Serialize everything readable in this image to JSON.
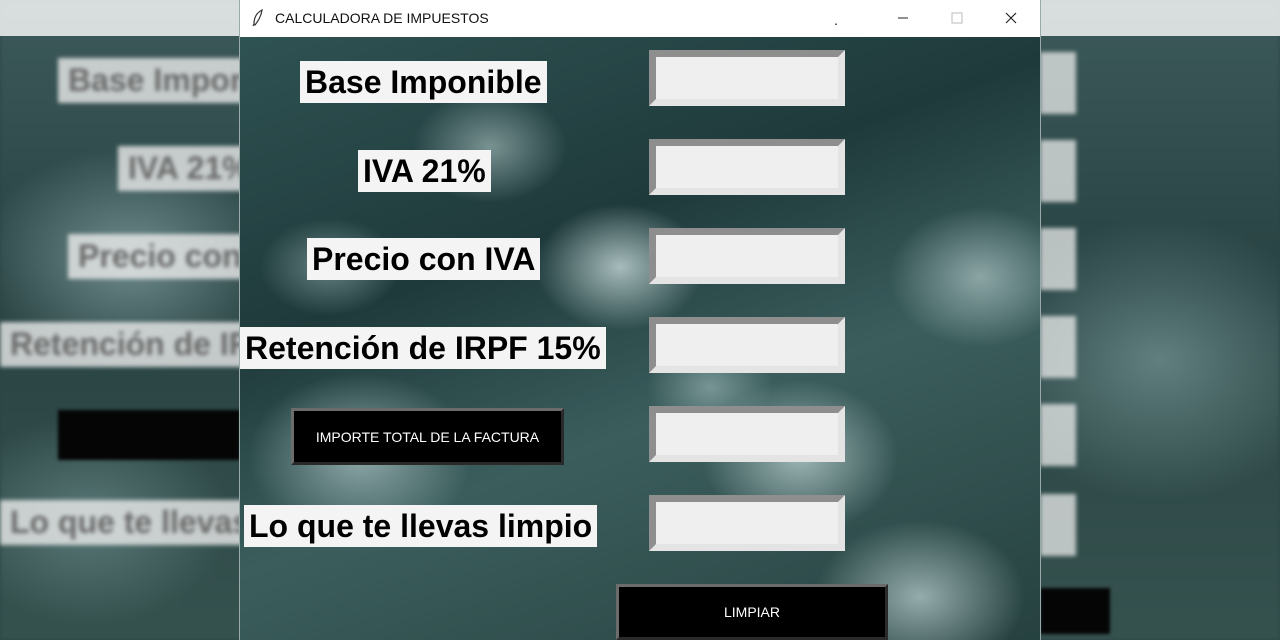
{
  "window": {
    "title": "CALCULADORA DE IMPUESTOS",
    "title_dot": ".",
    "controls": {
      "minimize_icon": "minimize-icon",
      "maximize_icon": "maximize-icon",
      "close_icon": "close-icon"
    },
    "app_icon": "feather-icon"
  },
  "form": {
    "base_label": "Base Imponible",
    "base_value": "",
    "iva_label": "IVA 21%",
    "iva_value": "",
    "precio_label": "Precio con IVA",
    "precio_value": "",
    "irpf_label": "Retención de IRPF 15%",
    "irpf_value": "",
    "total_button": "IMPORTE TOTAL DE LA FACTURA",
    "total_value": "",
    "limpio_label": "Lo que te llevas limpio",
    "limpio_value": "",
    "clear_button": "LIMPIAR"
  },
  "colors": {
    "button_bg": "#000000",
    "button_text": "#ffffff",
    "field_bg": "#efefef",
    "label_bg": "#f4f4f4"
  }
}
